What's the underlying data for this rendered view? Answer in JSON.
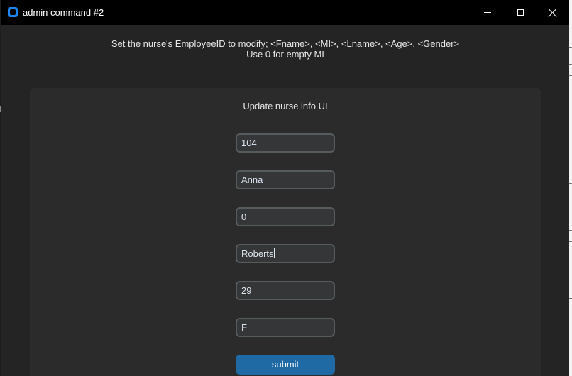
{
  "window": {
    "title": "admin command #2",
    "controls": {
      "minimize": "minimize-icon",
      "maximize": "maximize-icon",
      "close": "close-icon"
    }
  },
  "instructions": {
    "line1": "Set the nurse's EmployeeID to modify; <Fname>, <MI>, <Lname>, <Age>, <Gender>",
    "line2": "Use 0 for empty MI"
  },
  "form": {
    "title": "Update nurse info UI",
    "fields": [
      {
        "name": "employee-id-field",
        "value": "104"
      },
      {
        "name": "fname-field",
        "value": "Anna"
      },
      {
        "name": "mi-field",
        "value": "0"
      },
      {
        "name": "lname-field",
        "value": "Roberts"
      },
      {
        "name": "age-field",
        "value": "29"
      },
      {
        "name": "gender-field",
        "value": "F"
      }
    ],
    "submit_label": "submit"
  },
  "colors": {
    "titlebar": "#000000",
    "window_bg": "#242424",
    "panel_bg": "#2b2b2b",
    "field_bg": "#343638",
    "field_border": "#565b5e",
    "accent": "#1f6aa5"
  }
}
